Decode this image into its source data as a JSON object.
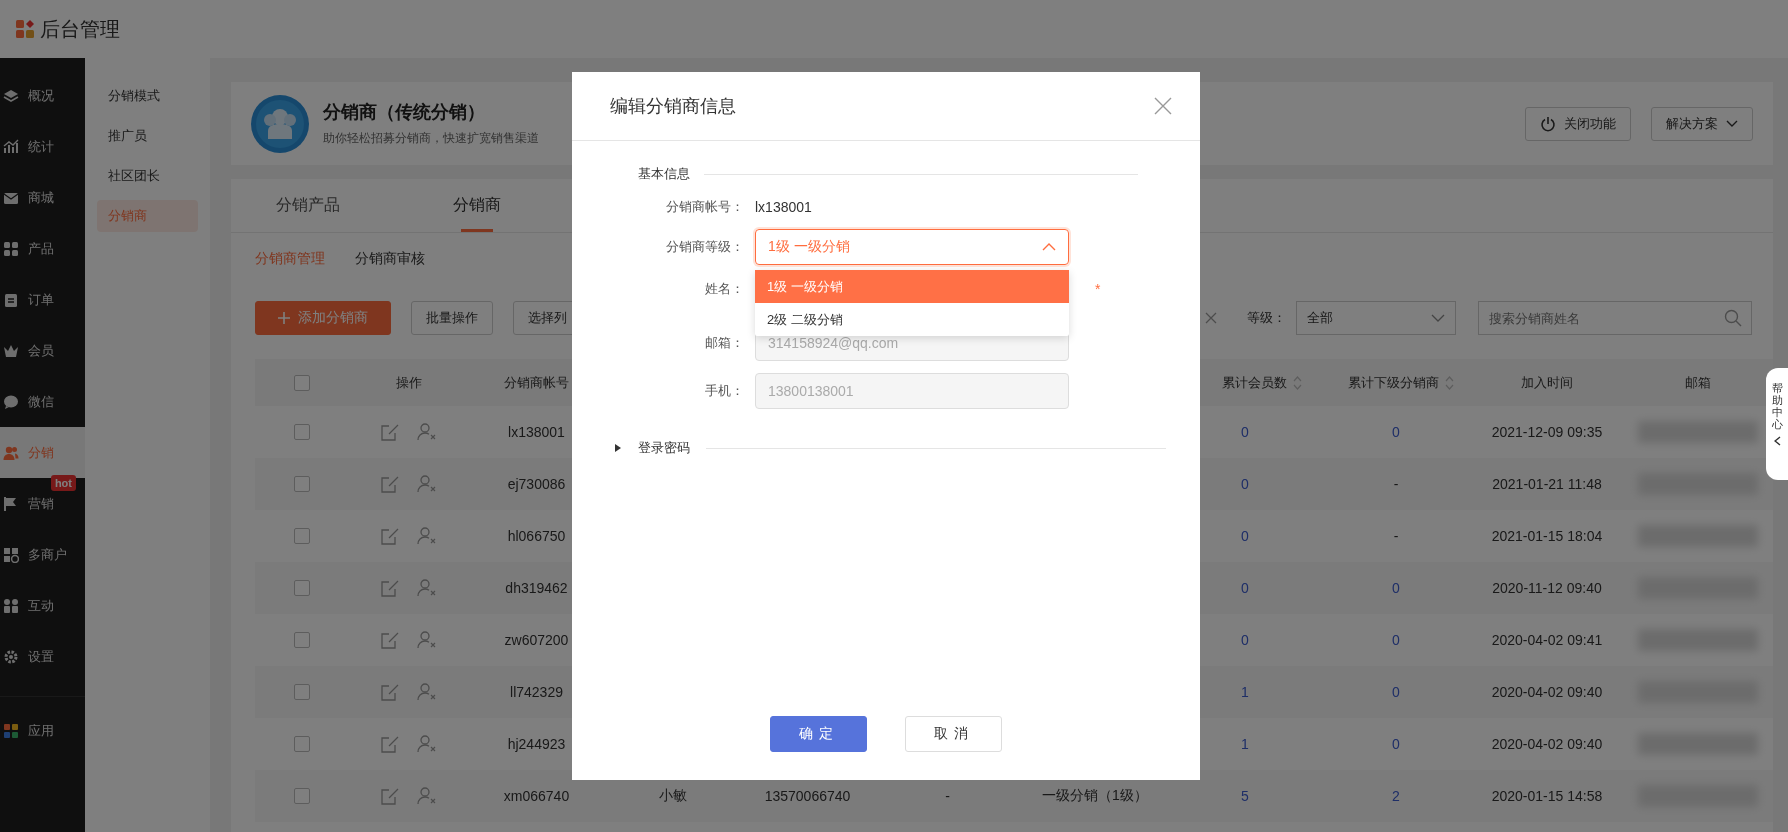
{
  "app": {
    "title": "后台管理"
  },
  "nav": {
    "main": [
      {
        "label": "概况",
        "selected": false
      },
      {
        "label": "统计",
        "selected": false
      },
      {
        "label": "商城",
        "selected": false
      },
      {
        "label": "产品",
        "selected": false
      },
      {
        "label": "订单",
        "selected": false
      },
      {
        "label": "会员",
        "selected": false
      },
      {
        "label": "微信",
        "selected": false
      },
      {
        "label": "分销",
        "selected": true
      },
      {
        "label": "营销",
        "selected": false,
        "badge": "hot"
      },
      {
        "label": "多商户",
        "selected": false
      },
      {
        "label": "互动",
        "selected": false
      },
      {
        "label": "设置",
        "selected": false
      }
    ],
    "bottom": [
      {
        "label": "应用",
        "selected": false
      }
    ]
  },
  "subnav": [
    {
      "label": "分销模式",
      "selected": false
    },
    {
      "label": "推广员",
      "selected": false
    },
    {
      "label": "社区团长",
      "selected": false
    },
    {
      "label": "分销商",
      "selected": true
    }
  ],
  "header_card": {
    "title": "分销商（传统分销）",
    "subtitle": "助你轻松招募分销商，快速扩宽销售渠道",
    "buttons": [
      {
        "label": "关闭功能",
        "kind": "power"
      },
      {
        "label": "解决方案",
        "kind": "dropdown"
      }
    ]
  },
  "tabs": [
    {
      "label": "分销产品",
      "selected": false
    },
    {
      "label": "分销商",
      "selected": true
    }
  ],
  "subtabs": [
    {
      "label": "分销商管理",
      "selected": true
    },
    {
      "label": "分销商审核",
      "selected": false
    }
  ],
  "toolbar": {
    "buttons": [
      {
        "label": "添加分销商",
        "kind": "primary"
      },
      {
        "label": "批量操作",
        "kind": "plain"
      },
      {
        "label": "选择列",
        "kind": "plain"
      }
    ],
    "level_filter": {
      "label": "等级：",
      "value": "全部"
    },
    "search": {
      "placeholder": "搜索分销商姓名"
    }
  },
  "table": {
    "columns": [
      {
        "kind": "checkbox",
        "checked": false
      },
      {
        "kind": "text",
        "label": "操作"
      },
      {
        "kind": "text",
        "label": "分销商帐号"
      },
      {
        "kind": "hidden"
      },
      {
        "kind": "hidden"
      },
      {
        "kind": "hidden"
      },
      {
        "kind": "hidden"
      },
      {
        "kind": "sort",
        "label": "累计会员数"
      },
      {
        "kind": "sort",
        "label": "累计下级分销商"
      },
      {
        "kind": "text",
        "label": "加入时间"
      },
      {
        "kind": "text",
        "label": "邮箱"
      }
    ],
    "rows": [
      {
        "checked": false,
        "account": "lx138001",
        "members": {
          "text": "0",
          "link": true
        },
        "sub_distributors": {
          "text": "0",
          "link": true
        },
        "joined": "2021-12-09 09:35"
      },
      {
        "checked": false,
        "account": "ej730086",
        "members": {
          "text": "0",
          "link": true
        },
        "sub_distributors": {
          "text": "-",
          "link": false
        },
        "joined": "2021-01-21 11:48"
      },
      {
        "checked": false,
        "account": "hl066750",
        "members": {
          "text": "0",
          "link": true
        },
        "sub_distributors": {
          "text": "-",
          "link": false
        },
        "joined": "2021-01-15 18:04"
      },
      {
        "checked": false,
        "account": "dh319462",
        "members": {
          "text": "0",
          "link": true
        },
        "sub_distributors": {
          "text": "0",
          "link": true
        },
        "joined": "2020-11-12 09:40"
      },
      {
        "checked": false,
        "account": "zw607200",
        "members": {
          "text": "0",
          "link": true
        },
        "sub_distributors": {
          "text": "0",
          "link": true
        },
        "joined": "2020-04-02 09:41"
      },
      {
        "checked": false,
        "account": "ll742329",
        "members": {
          "text": "1",
          "link": true
        },
        "sub_distributors": {
          "text": "0",
          "link": true
        },
        "joined": "2020-04-02 09:40"
      },
      {
        "checked": false,
        "account": "hj244923",
        "members": {
          "text": "1",
          "link": true
        },
        "sub_distributors": {
          "text": "0",
          "link": true
        },
        "joined": "2020-04-02 09:40"
      },
      {
        "checked": false,
        "account": "xm066740",
        "column_4": "小敏",
        "column_5": "13570066740",
        "column_6": "-",
        "column_7": "一级分销（1级）",
        "members": {
          "text": "5",
          "link": true
        },
        "sub_distributors": {
          "text": "2",
          "link": true
        },
        "joined": "2020-01-15 14:58"
      }
    ]
  },
  "dialog": {
    "title": "编辑分销商信息",
    "section": "基本信息",
    "account": {
      "label": "分销商帐号：",
      "value": "lx138001"
    },
    "level": {
      "label": "分销商等级：",
      "value": "1级 一级分销",
      "expanded": true,
      "options": [
        {
          "label": "1级 一级分销",
          "selected": true
        },
        {
          "label": "2级 二级分销",
          "selected": false
        }
      ]
    },
    "name": {
      "label": "姓名：",
      "required_mark": "*"
    },
    "email": {
      "label": "邮箱：",
      "value": "314158924@qq.com",
      "disabled": true
    },
    "phone": {
      "label": "手机：",
      "value": "13800138001",
      "disabled": true
    },
    "password_section": {
      "label": "登录密码",
      "expanded": false
    },
    "buttons": [
      {
        "label": "确定",
        "kind": "primary"
      },
      {
        "label": "取消",
        "kind": "plain"
      }
    ]
  },
  "help_tab": {
    "label": "帮助中心"
  }
}
